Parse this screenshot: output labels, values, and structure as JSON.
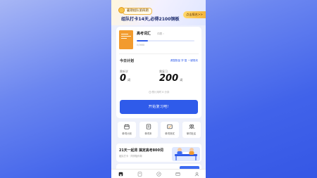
{
  "colors": {
    "background_top": "#a7b6f5",
    "background_bottom": "#3557e5",
    "primary": "#2f5bea",
    "cta": "#f5b53c",
    "book_cover": "#f29b2e"
  },
  "promo": {
    "tag": "暑期组队第四期",
    "headline": "组队打卡14天,必得2100铜板",
    "cta": "点击报名>>",
    "icon": "coin-icon"
  },
  "book": {
    "title": "高考词汇",
    "wordlist_link": "词表 ›",
    "progress": 0.2,
    "progress_text": "0/3668",
    "cover_icon": "book-cover"
  },
  "plan": {
    "title": "今日计划",
    "adjust": "调整数量 学·复 一键规划",
    "new_label": "需新学",
    "new_count": "0",
    "review_label": "需复习",
    "review_count": "200",
    "unit": "词",
    "estimate": "预计用时 8 分钟",
    "start_button": "开始复习吧!"
  },
  "shortcuts": [
    {
      "label": "单词计划",
      "icon": "calendar-icon"
    },
    {
      "label": "单词本",
      "icon": "wordbook-icon"
    },
    {
      "label": "单词测试",
      "icon": "test-icon"
    },
    {
      "label": "单词社区",
      "icon": "community-icon"
    }
  ],
  "banner": {
    "title": "21天一起背 搞定高考800词",
    "subtitle": "组队打卡 · 同学陪你背",
    "illustration": "study-group-illustration"
  },
  "nav": [
    {
      "icon": "home-icon",
      "active": true
    },
    {
      "icon": "book-icon",
      "active": false
    },
    {
      "icon": "discover-icon",
      "active": false
    },
    {
      "icon": "message-icon",
      "active": false
    },
    {
      "icon": "profile-icon",
      "active": false
    }
  ]
}
